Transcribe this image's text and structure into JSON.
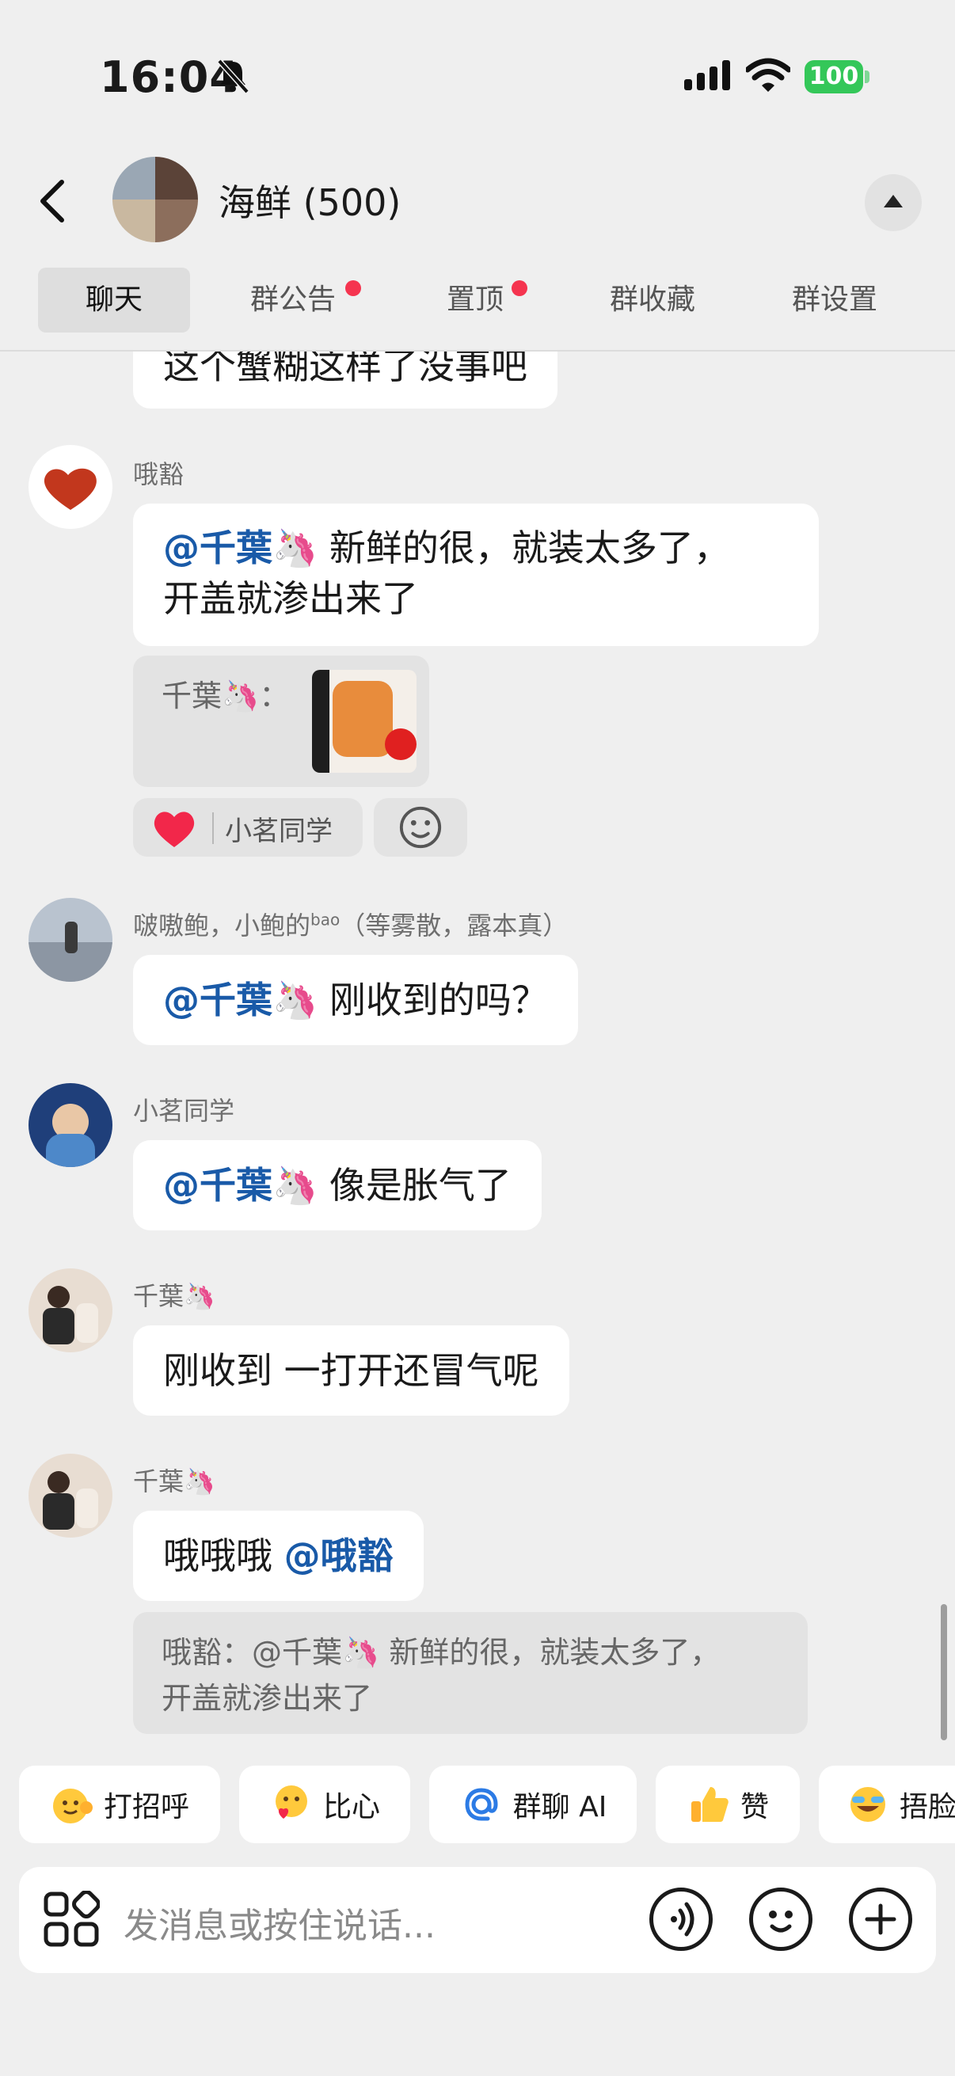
{
  "status_bar": {
    "time": "16:04",
    "battery": "100"
  },
  "header": {
    "title": "海鲜 (500)"
  },
  "tabs": [
    {
      "label": "聊天"
    },
    {
      "label": "群公告"
    },
    {
      "label": "置顶"
    },
    {
      "label": "群收藏"
    },
    {
      "label": "群设置"
    }
  ],
  "messages": {
    "m0": {
      "text": "这个蟹糊这样了没事吧"
    },
    "m1": {
      "sender": "哦豁",
      "mention": "@千葉🦄",
      "text_line1": " 新鲜的很，就装太多了，",
      "text_line2": "开盖就渗出来了",
      "quote_name": "千葉🦄：",
      "reaction_user": "小茗同学"
    },
    "m2": {
      "sender": "啵嗷鲍，小鲍的",
      "sender_sup": "bao",
      "sender_suffix": "（等雾散，露本真）",
      "mention": "@千葉🦄",
      "text": " 刚收到的吗？"
    },
    "m3": {
      "sender": "小茗同学",
      "mention": "@千葉🦄",
      "text": " 像是胀气了"
    },
    "m4": {
      "sender": "千葉🦄",
      "text": "刚收到 一打开还冒气呢"
    },
    "m5": {
      "sender": "千葉🦄",
      "text": "哦哦哦 ",
      "mention": "@哦豁",
      "quote_line1": "哦豁：@千葉🦄 新鲜的很，就装太多了，",
      "quote_line2": "开盖就渗出来了"
    }
  },
  "quick_replies": [
    {
      "label": "打招呼",
      "icon": "wave-emoji-icon"
    },
    {
      "label": "比心",
      "icon": "heart-hands-emoji-icon"
    },
    {
      "label": "群聊 AI",
      "icon": "at-icon"
    },
    {
      "label": "赞",
      "icon": "thumbs-up-icon"
    },
    {
      "label": "捂脸",
      "icon": "facepalm-emoji-icon"
    }
  ],
  "input": {
    "placeholder": "发消息或按住说话..."
  },
  "colors": {
    "mention": "#195aa8",
    "badge": "#f5344f",
    "battery": "#34c759",
    "background": "#efefef"
  }
}
